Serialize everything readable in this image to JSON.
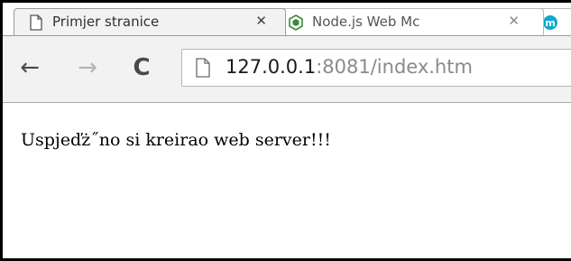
{
  "tabs": [
    {
      "title": "Primjer stranice",
      "close": "✕",
      "icon": "page-icon",
      "active": true
    },
    {
      "title": "Node.js Web Mc",
      "close": "✕",
      "icon": "nodejs-logo-icon",
      "active": false
    },
    {
      "title": "m",
      "icon": "m-logo-icon",
      "active": false
    }
  ],
  "toolbar": {
    "back": "←",
    "forward": "→",
    "reload": "C",
    "url_host": "127.0.0.1",
    "url_rest": ":8081/index.htm"
  },
  "content": {
    "text": "Uspjeďż˝no si kreirao web server!!!"
  },
  "colors": {
    "tab_active_bg": "#f2f2f2",
    "toolbar_bg": "#f2f2f2",
    "nodejs_green": "#3c873a",
    "m_logo_cyan": "#11a8cd"
  }
}
